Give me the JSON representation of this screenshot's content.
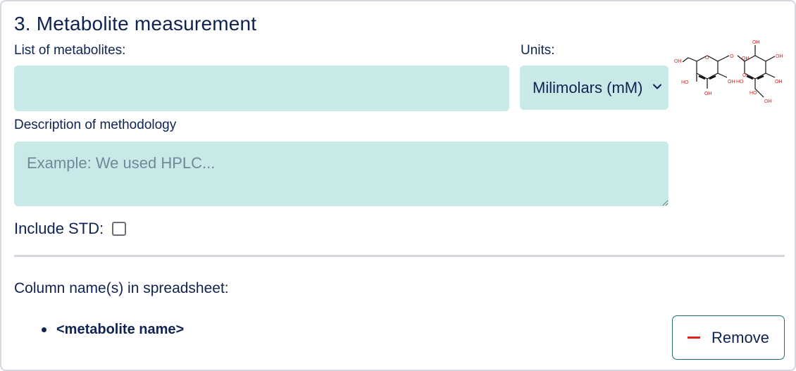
{
  "section": {
    "title": "3. Metabolite measurement"
  },
  "fields": {
    "metabolites_label": "List of metabolites:",
    "metabolites_value": "",
    "units_label": "Units:",
    "units_selected": "Milimolars (mM)",
    "description_label": "Description of methodology",
    "description_placeholder": "Example: We used HPLC...",
    "include_std_label": "Include STD:",
    "include_std_checked": false
  },
  "columns": {
    "heading": "Column name(s) in spreadsheet:",
    "items": [
      "<metabolite name>"
    ]
  },
  "actions": {
    "remove_label": "Remove"
  },
  "molecule": {
    "atoms": [
      "OH",
      "O",
      "O",
      "OH",
      "OH",
      "OH",
      "HO",
      "OH",
      "HO",
      "OH",
      "OH",
      "O",
      "HO",
      "OH"
    ]
  },
  "colors": {
    "text": "#0f2352",
    "input_bg": "#c8e9e7",
    "accent_border": "#1b6f6f",
    "remove_icon": "#e0231f",
    "atom_label": "#e0231f"
  }
}
